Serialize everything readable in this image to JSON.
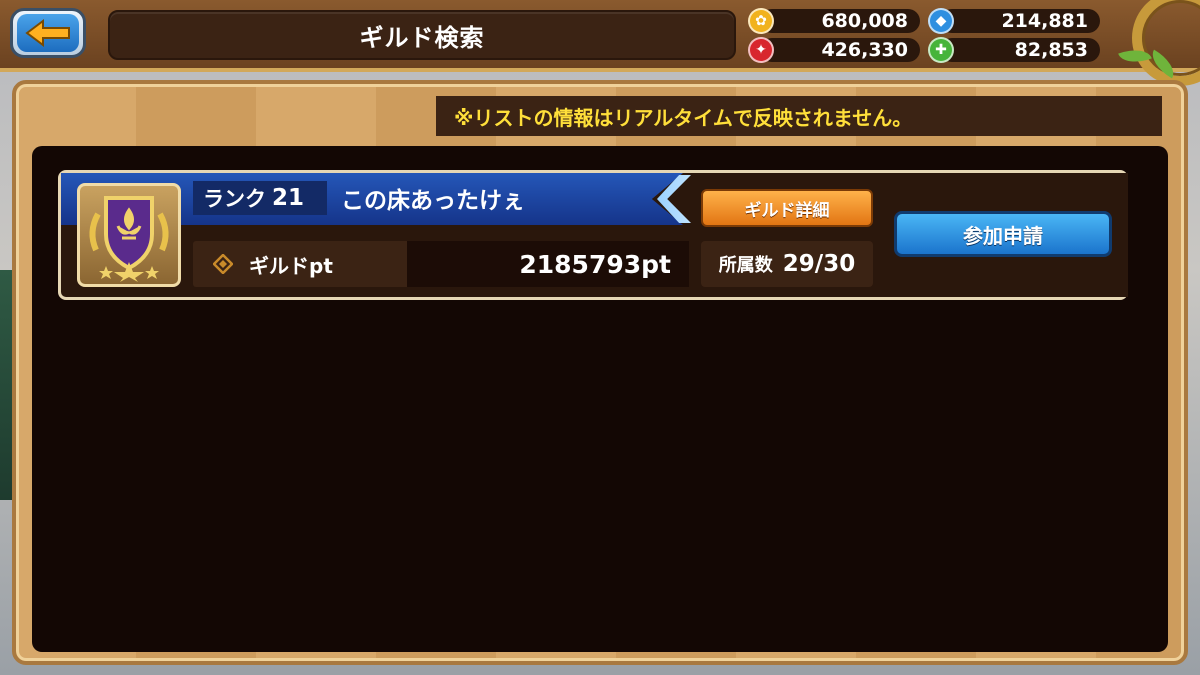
{
  "header": {
    "title": "ギルド検索"
  },
  "currencies": [
    {
      "icon": "gold-coin-icon",
      "value": "680,008",
      "color": "#f1b21e"
    },
    {
      "icon": "blue-orb-icon",
      "value": "214,881",
      "color": "#2e8fe0"
    },
    {
      "icon": "red-orb-icon",
      "value": "426,330",
      "color": "#d8262e"
    },
    {
      "icon": "green-orb-icon",
      "value": "82,853",
      "color": "#46b43a"
    }
  ],
  "notice": "※リストの情報はリアルタイムで反映されません。",
  "guilds": [
    {
      "rank_label": "ランク",
      "rank": "21",
      "name": "この床あったけぇ",
      "detail_button": "ギルド詳細",
      "pt_label": "ギルドpt",
      "pt_value": "2185793pt",
      "members_label": "所属数",
      "members_value": "29/30",
      "join_button": "参加申請"
    }
  ],
  "colors": {
    "accent_blue": "#1b74cc",
    "accent_orange": "#e27513",
    "notice_yellow": "#ffdf3a",
    "panel_dark": "#130704"
  }
}
